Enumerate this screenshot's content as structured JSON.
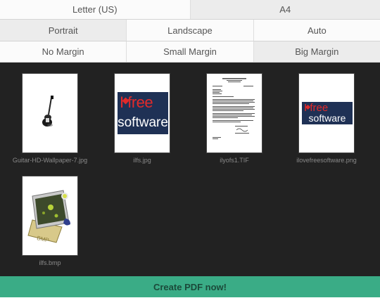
{
  "page_size": {
    "options": [
      "Letter (US)",
      "A4"
    ],
    "selected": "A4"
  },
  "orientation": {
    "options": [
      "Portrait",
      "Landscape",
      "Auto"
    ],
    "selected": "Portrait"
  },
  "margin": {
    "options": [
      "No Margin",
      "Small Margin",
      "Big Margin"
    ],
    "selected": "Big Margin"
  },
  "images": [
    {
      "filename": "Guitar-HD-Wallpaper-7.jpg",
      "icon": "guitar-image"
    },
    {
      "filename": "ilfs.jpg",
      "icon": "ilovefreesoftware-logo-image"
    },
    {
      "filename": "ilyofs1.TIF",
      "icon": "scanned-letter-document-image"
    },
    {
      "filename": "ilovefreesoftware.png",
      "icon": "ilovefreesoftware-logo-image"
    },
    {
      "filename": "ilfs.bmp",
      "icon": "bmp-file-icon-image"
    }
  ],
  "logo_text": {
    "top": "I free",
    "bottom": "software"
  },
  "create_button": {
    "label": "Create PDF now!"
  },
  "colors": {
    "accent": "#3aac86",
    "gallery_bg": "#222222",
    "selected_option": "#ececec",
    "option_bg": "#fbfbfb"
  }
}
